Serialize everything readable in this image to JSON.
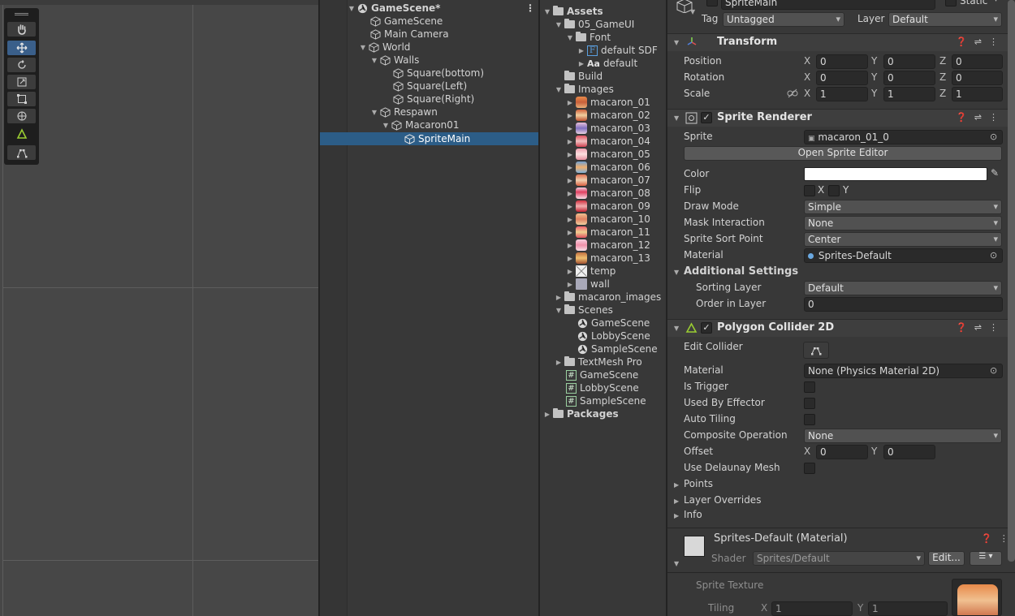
{
  "hierarchy": {
    "rows": [
      {
        "label": "GameScene*"
      },
      {
        "label": "GameScene"
      },
      {
        "label": "Main Camera"
      },
      {
        "label": "World"
      },
      {
        "label": "Walls"
      },
      {
        "label": "Square(bottom)"
      },
      {
        "label": "Square(Left)"
      },
      {
        "label": "Square(Right)"
      },
      {
        "label": "Respawn"
      },
      {
        "label": "Macaron01"
      },
      {
        "label": "SpriteMain"
      }
    ],
    "menu_icon": "⋮"
  },
  "project": {
    "rows": [
      {
        "label": "Assets"
      },
      {
        "label": "05_GameUI"
      },
      {
        "label": "Font"
      },
      {
        "label": "default SDF"
      },
      {
        "label": "default"
      },
      {
        "label": "Build"
      },
      {
        "label": "Images"
      },
      {
        "label": "macaron_01"
      },
      {
        "label": "macaron_02"
      },
      {
        "label": "macaron_03"
      },
      {
        "label": "macaron_04"
      },
      {
        "label": "macaron_05"
      },
      {
        "label": "macaron_06"
      },
      {
        "label": "macaron_07"
      },
      {
        "label": "macaron_08"
      },
      {
        "label": "macaron_09"
      },
      {
        "label": "macaron_10"
      },
      {
        "label": "macaron_11"
      },
      {
        "label": "macaron_12"
      },
      {
        "label": "macaron_13"
      },
      {
        "label": "temp"
      },
      {
        "label": "wall"
      },
      {
        "label": "macaron_images"
      },
      {
        "label": "Scenes"
      },
      {
        "label": "GameScene"
      },
      {
        "label": "LobbyScene"
      },
      {
        "label": "SampleScene"
      },
      {
        "label": "TextMesh Pro"
      },
      {
        "label": "GameScene"
      },
      {
        "label": "LobbyScene"
      },
      {
        "label": "SampleScene"
      },
      {
        "label": "Packages"
      }
    ],
    "font_icon_text": "F",
    "aa_icon_text": "Aa",
    "script_icon_text": "#"
  },
  "inspector": {
    "object_name": "SpriteMain",
    "static_label": "Static",
    "tag_label": "Tag",
    "tag_value": "Untagged",
    "layer_label": "Layer",
    "layer_value": "Default",
    "axis": {
      "x": "X",
      "y": "Y",
      "z": "Z"
    },
    "transform": {
      "title": "Transform",
      "position_label": "Position",
      "rotation_label": "Rotation",
      "scale_label": "Scale",
      "position": [
        "0",
        "0",
        "0"
      ],
      "rotation": [
        "0",
        "0",
        "0"
      ],
      "scale": [
        "1",
        "1",
        "1"
      ]
    },
    "sprite_renderer": {
      "title": "Sprite Renderer",
      "sprite_label": "Sprite",
      "sprite_value": "macaron_01_0",
      "open_editor_button": "Open Sprite Editor",
      "color_label": "Color",
      "flip_label": "Flip",
      "flip_x": "X",
      "flip_y": "Y",
      "draw_mode_label": "Draw Mode",
      "draw_mode_value": "Simple",
      "mask_label": "Mask Interaction",
      "mask_value": "None",
      "sort_point_label": "Sprite Sort Point",
      "sort_point_value": "Center",
      "material_label": "Material",
      "material_value": "Sprites-Default",
      "additional_title": "Additional Settings",
      "sorting_layer_label": "Sorting Layer",
      "sorting_layer_value": "Default",
      "order_label": "Order in Layer",
      "order_value": "0"
    },
    "polygon_collider": {
      "title": "Polygon Collider 2D",
      "edit_collider_label": "Edit Collider",
      "material_label": "Material",
      "material_value": "None (Physics Material 2D)",
      "is_trigger_label": "Is Trigger",
      "used_by_effector_label": "Used By Effector",
      "auto_tiling_label": "Auto Tiling",
      "composite_label": "Composite Operation",
      "composite_value": "None",
      "offset_label": "Offset",
      "offset": [
        "0",
        "0"
      ],
      "delaunay_label": "Use Delaunay Mesh",
      "points_label": "Points",
      "layer_overrides_label": "Layer Overrides",
      "info_label": "Info"
    },
    "material_section": {
      "title": "Sprites-Default (Material)",
      "shader_label": "Shader",
      "shader_value": "Sprites/Default",
      "edit_button": "Edit...",
      "sprite_texture_label": "Sprite Texture",
      "tiling_label": "Tiling",
      "tiling": [
        "1",
        "1"
      ]
    }
  },
  "colors": {
    "selection": "#2c5d87",
    "collider_green": "#9acd32",
    "panel_bg": "#383838",
    "scene_bg": "#474747"
  }
}
